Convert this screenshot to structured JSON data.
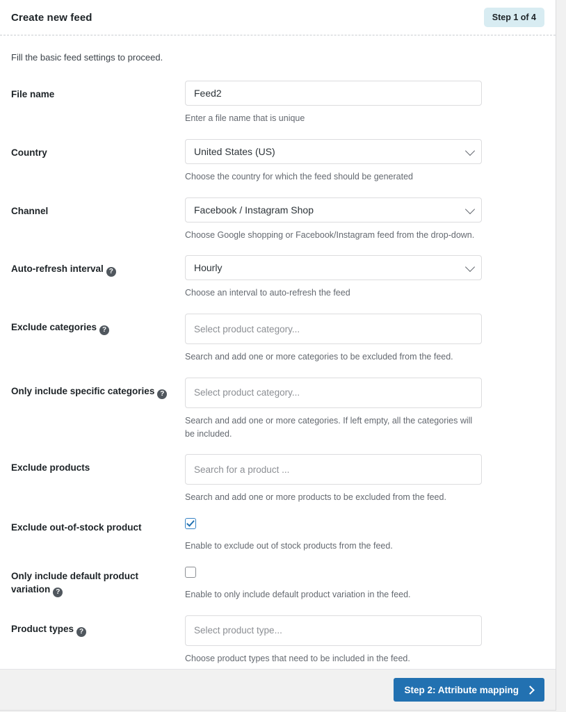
{
  "header": {
    "title": "Create new feed",
    "step_badge": "Step 1 of 4"
  },
  "body": {
    "intro": "Fill the basic feed settings to proceed."
  },
  "fields": {
    "file_name": {
      "label": "File name",
      "value": "Feed2",
      "description": "Enter a file name that is unique"
    },
    "country": {
      "label": "Country",
      "value": "United States (US)",
      "description": "Choose the country for which the feed should be generated",
      "options": [
        "United States (US)"
      ]
    },
    "channel": {
      "label": "Channel",
      "value": "Facebook / Instagram Shop",
      "description": "Choose Google shopping or Facebook/Instagram feed from the drop-down.",
      "options": [
        "Facebook / Instagram Shop"
      ]
    },
    "auto_refresh": {
      "label": "Auto-refresh interval",
      "help": "?",
      "value": "Hourly",
      "description": "Choose an interval to auto-refresh the feed",
      "options": [
        "Hourly"
      ]
    },
    "exclude_categories": {
      "label": "Exclude categories",
      "help": "?",
      "placeholder": "Select product category...",
      "description": "Search and add one or more categories to be excluded from the feed."
    },
    "include_categories": {
      "label": "Only include specific categories",
      "help": "?",
      "placeholder": "Select product category...",
      "description": "Search and add one or more categories. If left empty, all the categories will be included."
    },
    "exclude_products": {
      "label": "Exclude products",
      "placeholder": "Search for a product ...",
      "description": "Search and add one or more products to be excluded from the feed."
    },
    "exclude_out_of_stock": {
      "label": "Exclude out-of-stock product",
      "checked": true,
      "description": "Enable to exclude out of stock products from the feed."
    },
    "default_variation_only": {
      "label": "Only include default product variation",
      "help": "?",
      "checked": false,
      "description": "Enable to only include default product variation in the feed."
    },
    "product_types": {
      "label": "Product types",
      "help": "?",
      "placeholder": "Select product type...",
      "description": "Choose product types that need to be included in the feed."
    }
  },
  "footer": {
    "next_label": "Step 2: Attribute mapping"
  },
  "colors": {
    "accent": "#2271b1",
    "badge_bg": "#d8ecf2",
    "text": "#1d2327",
    "muted": "#646970",
    "border": "#dcdcde",
    "footer_bg": "#f1f1f1"
  }
}
